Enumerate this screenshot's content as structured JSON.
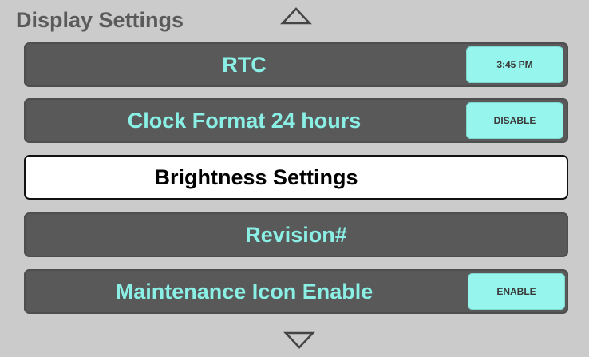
{
  "header": {
    "title": "Display Settings",
    "up_icon": "triangle-up-icon",
    "down_icon": "triangle-down-icon"
  },
  "menu": {
    "rtc": {
      "label": "RTC",
      "value": "3:45 PM"
    },
    "clock_format": {
      "label": "Clock Format 24 hours",
      "value": "DISABLE"
    },
    "brightness": {
      "label": "Brightness Settings"
    },
    "revision": {
      "label": "Revision#"
    },
    "maintenance": {
      "label": "Maintenance Icon Enable",
      "value": "ENABLE"
    }
  },
  "colors": {
    "background": "#cbcbcb",
    "row": "#595959",
    "accent_text": "#8af0e6",
    "pill": "#96f6ee",
    "selected_row": "#ffffff"
  }
}
